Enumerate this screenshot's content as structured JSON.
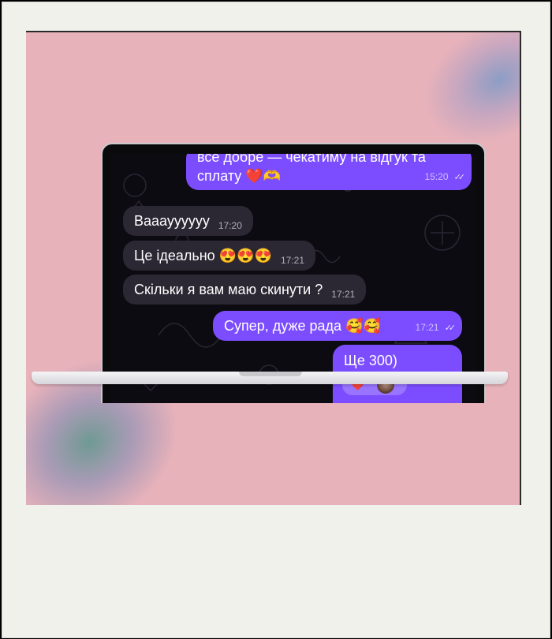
{
  "messages": [
    {
      "side": "out",
      "text": "все добре — чекатиму на відгук та",
      "text2": "сплату",
      "emoji": "❤️🫶",
      "time": "15:20",
      "read": "✓✓"
    },
    {
      "side": "in",
      "text": "Вааауууууу",
      "time": "17:20"
    },
    {
      "side": "in",
      "text": "Це ідеально",
      "emoji": "😍😍😍",
      "time": "17:21"
    },
    {
      "side": "in",
      "text": "Скільки я вам маю скинути ?",
      "time": "17:21"
    },
    {
      "side": "out",
      "text": "Супер, дуже рада",
      "emoji": "🥰🥰",
      "time": "17:21",
      "read": "✓✓"
    },
    {
      "side": "out",
      "text": "Ще 300)",
      "reaction": "❤️"
    }
  ],
  "colors": {
    "outgoing": "#7c4dff",
    "incoming": "#2b2733",
    "background": "#e8b2ba",
    "frame": "#f1f1ec"
  }
}
